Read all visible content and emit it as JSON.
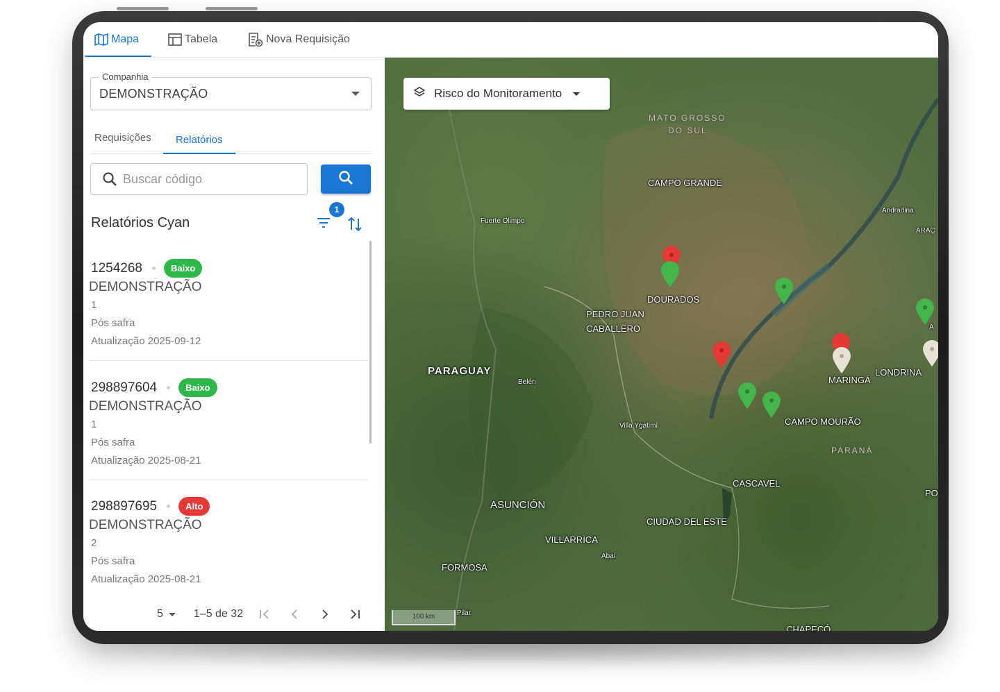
{
  "tabs": [
    {
      "label": "Mapa",
      "icon": "map-icon",
      "active": true
    },
    {
      "label": "Tabela",
      "icon": "table-icon",
      "active": false
    },
    {
      "label": "Nova Requisição",
      "icon": "new-request-icon",
      "active": false
    }
  ],
  "company": {
    "label": "Companhia",
    "value": "DEMONSTRAÇÃO"
  },
  "subtabs": [
    {
      "label": "Requisições",
      "active": false
    },
    {
      "label": "Relatórios",
      "active": true
    }
  ],
  "search": {
    "placeholder": "Buscar código"
  },
  "list": {
    "title": "Relatórios Cyan",
    "filter_count": "1",
    "items": [
      {
        "code": "1254268",
        "risk": "Baixo",
        "risk_color": "#2fb84a",
        "company": "DEMONSTRAÇÃO",
        "number": "1",
        "stage": "Pós safra",
        "updated": "Atualização 2025-09-12"
      },
      {
        "code": "298897604",
        "risk": "Baixo",
        "risk_color": "#2fb84a",
        "company": "DEMONSTRAÇÃO",
        "number": "1",
        "stage": "Pós safra",
        "updated": "Atualização 2025-08-21"
      },
      {
        "code": "298897695",
        "risk": "Alto",
        "risk_color": "#e53935",
        "company": "DEMONSTRAÇÃO",
        "number": "2",
        "stage": "Pós safra",
        "updated": "Atualização 2025-08-21"
      }
    ]
  },
  "pagination": {
    "page_size": "5",
    "range": "1–5 de 32"
  },
  "map": {
    "layer_control": "Risco do Monitoramento",
    "scale": "100 km",
    "labels": {
      "ms1": "MATO GROSSO",
      "ms2": "DO SUL",
      "campo_grande": "CAMPO GRANDE",
      "fuerte_olimpo": "Fuerte Olimpo",
      "andradina": "Andradina",
      "araca": "ARAÇ",
      "dourados": "DOURADOS",
      "pedro_juan": "PEDRO JUAN",
      "caballero": "CABALLERO",
      "paraguay": "PARAGUAY",
      "belen": "Belén",
      "maringa": "MARINGÁ",
      "londrina": "LONDRINA",
      "campo_mourao": "CAMPO MOURÃO",
      "villa_ygatimi": "Villa Ygatimí",
      "parana": "PARANÁ",
      "cascavel": "CASCAVEL",
      "asuncion": "ASUNCIÓN",
      "ciudad_del_este": "CIUDAD DEL ESTE",
      "villarrica": "VILLARRICA",
      "abai": "Abaí",
      "formosa": "FORMOSA",
      "pilar": "Pilar",
      "chapeco": "CHAPECÓ",
      "po": "PO",
      "a": "A"
    },
    "pin_colors": {
      "high": "#e53935",
      "low": "#43b54a",
      "none": "#e8e2d6"
    }
  }
}
